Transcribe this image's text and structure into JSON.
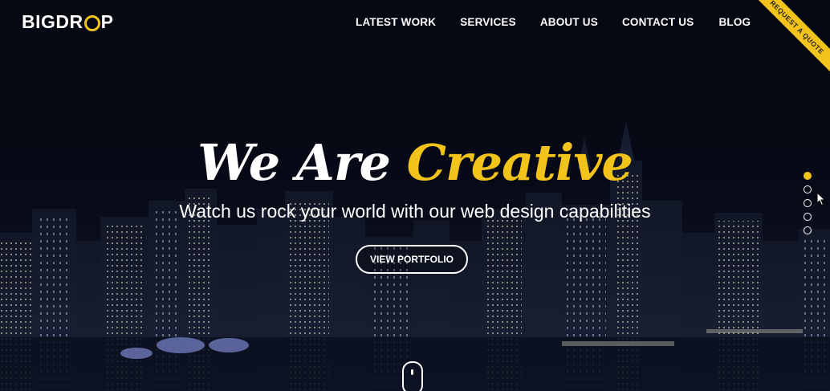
{
  "brand": {
    "part1": "BIGDR",
    "part2": "P",
    "accent": "#f2c31b"
  },
  "nav": {
    "items": [
      {
        "label": "LATEST WORK"
      },
      {
        "label": "SERVICES"
      },
      {
        "label": "ABOUT US"
      },
      {
        "label": "CONTACT US"
      },
      {
        "label": "BLOG"
      }
    ]
  },
  "ribbon": {
    "label": "REQUEST A QUOTE"
  },
  "hero": {
    "headline_white": "We Are",
    "headline_accent": "Creative",
    "subtitle": "Watch us rock your world with our web design capabilities",
    "cta_label": "VIEW PORTFOLIO"
  },
  "slider": {
    "count": 5,
    "active_index": 0
  },
  "icons": {
    "scroll": "mouse-scroll-icon",
    "cursor": "pointer-cursor-icon"
  }
}
